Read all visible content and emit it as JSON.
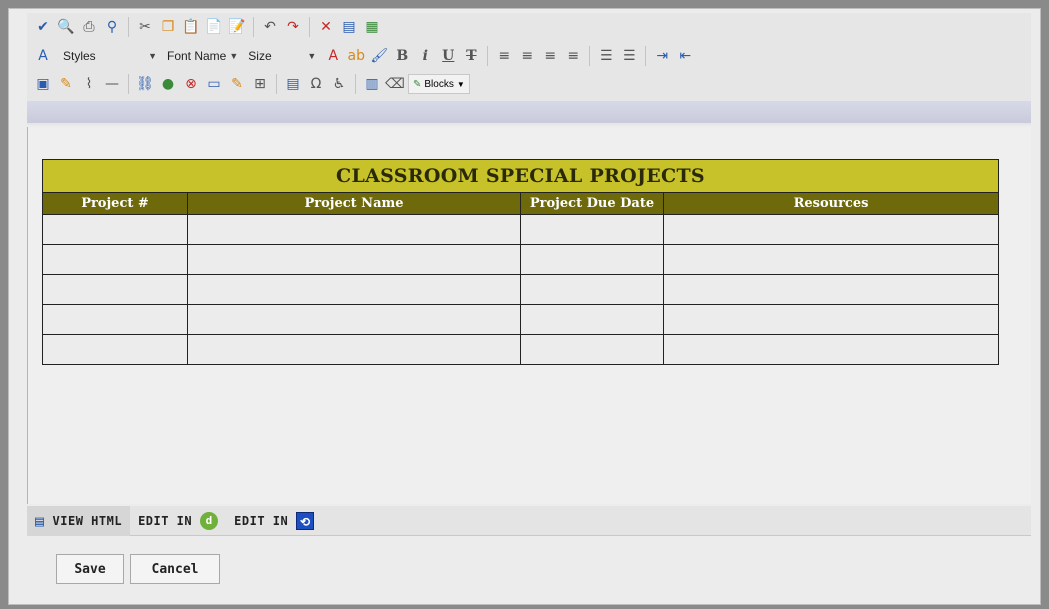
{
  "toolbar": {
    "row1": [
      {
        "name": "spellcheck-icon",
        "glyph": "✔"
      },
      {
        "name": "preview-icon",
        "glyph": "🔍"
      },
      {
        "name": "print-icon",
        "glyph": "⎙"
      },
      {
        "name": "find-icon",
        "glyph": "⚲"
      },
      {
        "sep": true
      },
      {
        "name": "cut-icon",
        "glyph": "✂"
      },
      {
        "name": "copy-icon",
        "glyph": "❐"
      },
      {
        "name": "paste-icon",
        "glyph": "📋"
      },
      {
        "name": "paste-text-icon",
        "glyph": "📄"
      },
      {
        "name": "paste-word-icon",
        "glyph": "📝"
      },
      {
        "sep": true
      },
      {
        "name": "undo-icon",
        "glyph": "↶"
      },
      {
        "name": "redo-icon",
        "glyph": "↷"
      },
      {
        "sep": true
      },
      {
        "name": "delete-icon",
        "glyph": "✕"
      },
      {
        "name": "select-all-icon",
        "glyph": "▤"
      },
      {
        "name": "template-icon",
        "glyph": "▦"
      }
    ],
    "styles_label": "Styles",
    "font_name_label": "Font Name",
    "size_label": "Size",
    "row2": [
      {
        "name": "font-color-icon",
        "glyph": "A"
      },
      {
        "name": "highlight-icon",
        "glyph": "ab"
      },
      {
        "name": "format-painter-icon",
        "glyph": "🖌"
      },
      {
        "name": "bold-icon",
        "glyph": "B"
      },
      {
        "name": "italic-icon",
        "glyph": "i"
      },
      {
        "name": "underline-icon",
        "glyph": "U"
      },
      {
        "name": "strikethrough-icon",
        "glyph": "T"
      },
      {
        "sep": true
      },
      {
        "name": "align-left-icon",
        "glyph": "≡"
      },
      {
        "name": "align-center-icon",
        "glyph": "≡"
      },
      {
        "name": "align-right-icon",
        "glyph": "≡"
      },
      {
        "name": "align-justify-icon",
        "glyph": "≡"
      },
      {
        "sep": true
      },
      {
        "name": "ordered-list-icon",
        "glyph": "☰"
      },
      {
        "name": "unordered-list-icon",
        "glyph": "☰"
      },
      {
        "sep": true
      },
      {
        "name": "indent-icon",
        "glyph": "⇥"
      },
      {
        "name": "outdent-icon",
        "glyph": "⇤"
      }
    ],
    "row3": [
      {
        "name": "image-icon",
        "glyph": "▣"
      },
      {
        "name": "image-properties-icon",
        "glyph": "✎"
      },
      {
        "name": "attachment-icon",
        "glyph": "⌇"
      },
      {
        "name": "horizontal-rule-icon",
        "glyph": "—"
      },
      {
        "sep": true
      },
      {
        "name": "hyperlink-icon",
        "glyph": "⛓"
      },
      {
        "name": "link-icon",
        "glyph": "●"
      },
      {
        "name": "unlink-icon",
        "glyph": "⊗"
      },
      {
        "name": "insert-table-icon",
        "glyph": "▭"
      },
      {
        "name": "table-properties-icon",
        "glyph": "✎"
      },
      {
        "name": "table-borders-icon",
        "glyph": "⊞"
      },
      {
        "sep": true
      },
      {
        "name": "form-icon",
        "glyph": "▤"
      },
      {
        "name": "special-char-icon",
        "glyph": "Ω"
      },
      {
        "name": "accessibility-icon",
        "glyph": "♿"
      },
      {
        "sep": true
      },
      {
        "name": "page-properties-icon",
        "glyph": "▥"
      },
      {
        "name": "eraser-icon",
        "glyph": "⌫"
      }
    ],
    "blocks_label": "Blocks"
  },
  "table": {
    "title": "CLASSROOM SPECIAL PROJECTS",
    "columns": [
      "Project #",
      "Project Name",
      "Project Due Date",
      "Resources"
    ],
    "row_count": 5
  },
  "modes": {
    "view_html": "VIEW HTML",
    "edit_in_1": "EDIT IN",
    "edit_in_2": "EDIT IN"
  },
  "buttons": {
    "save": "Save",
    "cancel": "Cancel"
  }
}
